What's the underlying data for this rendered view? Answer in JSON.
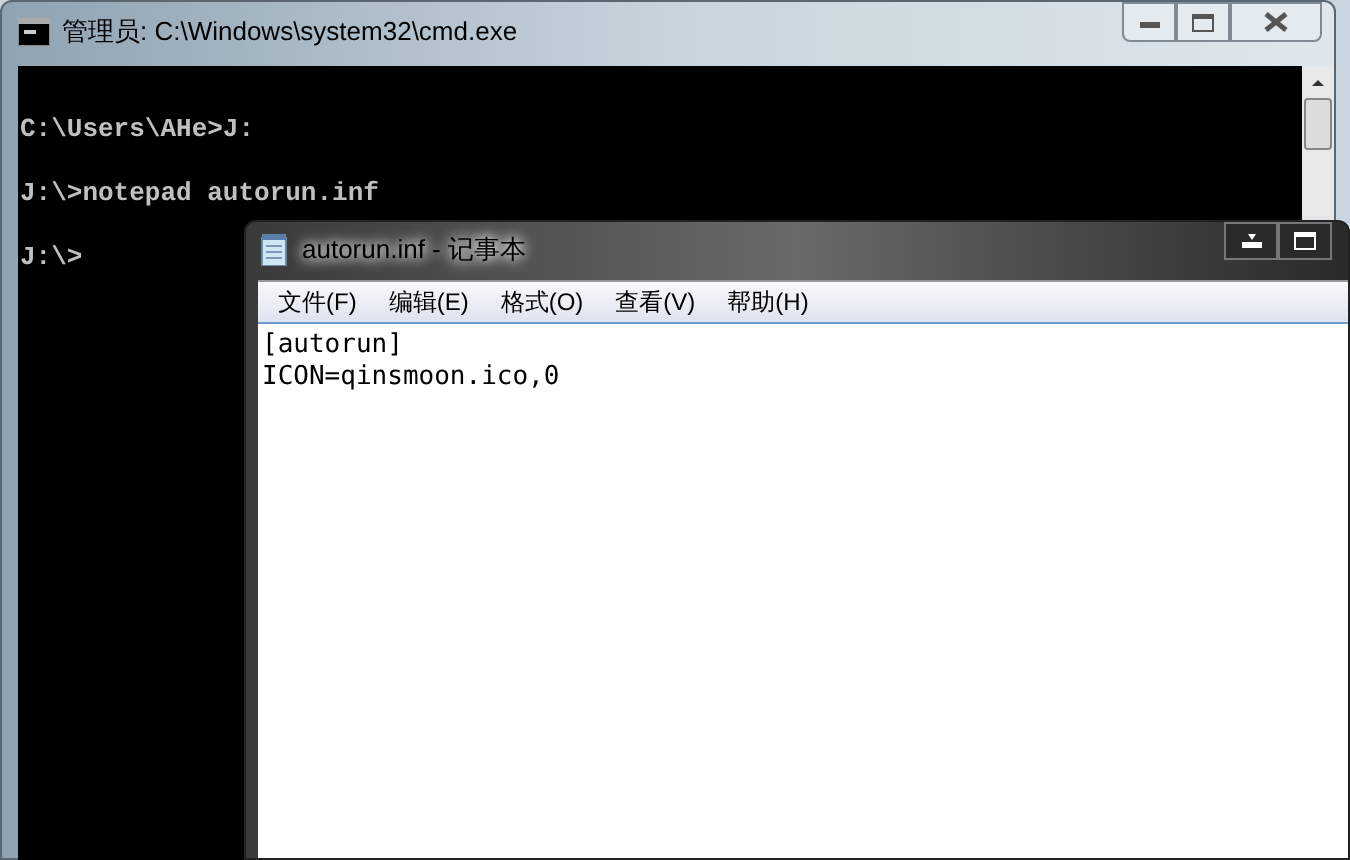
{
  "cmd_window": {
    "title": "管理员: C:\\Windows\\system32\\cmd.exe",
    "lines": [
      "C:\\Users\\AHe>J:",
      "J:\\>notepad autorun.inf",
      "J:\\>"
    ]
  },
  "notepad_window": {
    "title": "autorun.inf - 记事本",
    "menu": [
      "文件(F)",
      "编辑(E)",
      "格式(O)",
      "查看(V)",
      "帮助(H)"
    ],
    "lines": [
      "[autorun]",
      "ICON=qinsmoon.ico,0"
    ]
  }
}
